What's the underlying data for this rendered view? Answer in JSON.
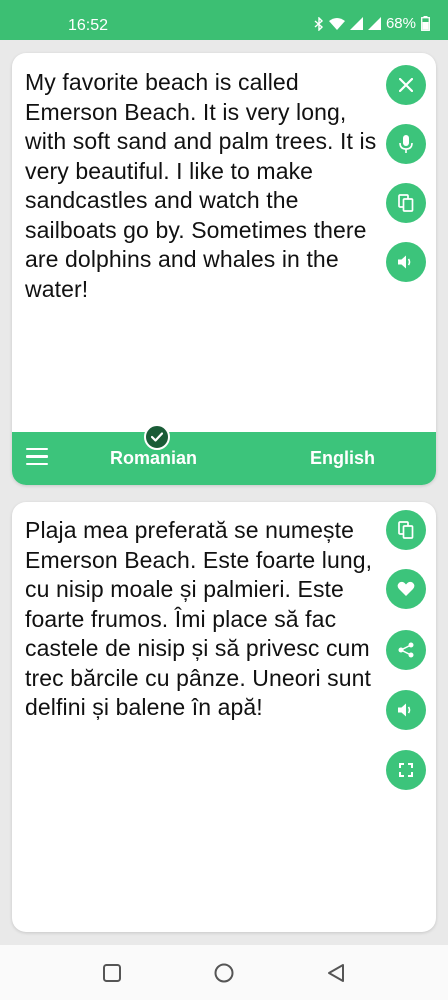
{
  "status_bar": {
    "time": "16:52",
    "battery": "68%",
    "icons": [
      "bluetooth-icon",
      "wifi-icon",
      "signal-icon",
      "signal-icon",
      "battery-icon"
    ]
  },
  "source": {
    "text": "My favorite beach is called Emerson Beach. It is very long, with soft sand and palm trees. It is very beautiful. I like to make sandcastles and watch the sailboats go by. Sometimes there are dolphins and whales in the water!",
    "actions": [
      "close-icon",
      "microphone-icon",
      "copy-icon",
      "speaker-icon"
    ]
  },
  "languages": {
    "source": "Romanian",
    "target": "English"
  },
  "translation": {
    "text": "Plaja mea preferată se numește Emerson Beach. Este foarte lung, cu nisip moale și palmieri. Este foarte frumos. Îmi place să fac castele de nisip și să privesc cum trec bărcile cu pânze. Uneori sunt delfini și balene în apă!",
    "actions": [
      "copy-icon",
      "heart-icon",
      "share-icon",
      "speaker-icon",
      "fullscreen-icon"
    ]
  },
  "colors": {
    "accent": "#3cc47b",
    "status_bar": "#3cbf73",
    "badge": "#1a5c37"
  },
  "nav_bar": [
    "recents-icon",
    "home-icon",
    "back-icon"
  ]
}
